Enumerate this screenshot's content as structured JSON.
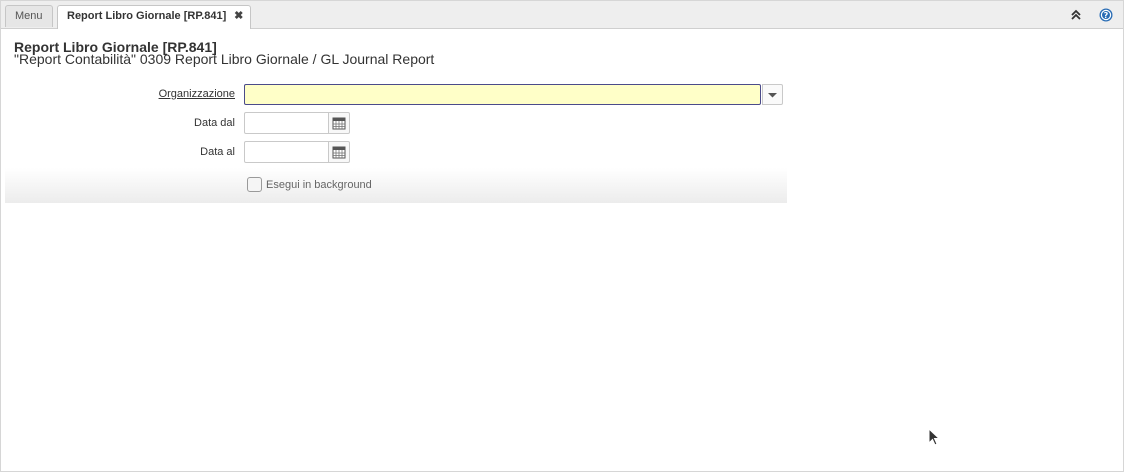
{
  "tabs": {
    "menu_label": "Menu",
    "active_label": "Report Libro Giornale [RP.841]",
    "close_symbol": "✖"
  },
  "header": {
    "title": "Report Libro Giornale [RP.841]",
    "subtitle": "\"Report Contabilità\" 0309 Report Libro Giornale / GL Journal Report"
  },
  "form": {
    "organizzazione": {
      "label": "Organizzazione",
      "value": ""
    },
    "data_dal": {
      "label": "Data dal",
      "value": ""
    },
    "data_al": {
      "label": "Data al",
      "value": ""
    },
    "background": {
      "label": "Esegui in background",
      "checked": false
    }
  },
  "icons": {
    "collapse": "double-chevron-up-icon",
    "help": "help-icon",
    "dropdown": "chevron-down-icon",
    "calendar": "calendar-icon"
  },
  "colors": {
    "focus_field_bg": "#ffffc8",
    "help_blue": "#2a6db5"
  }
}
